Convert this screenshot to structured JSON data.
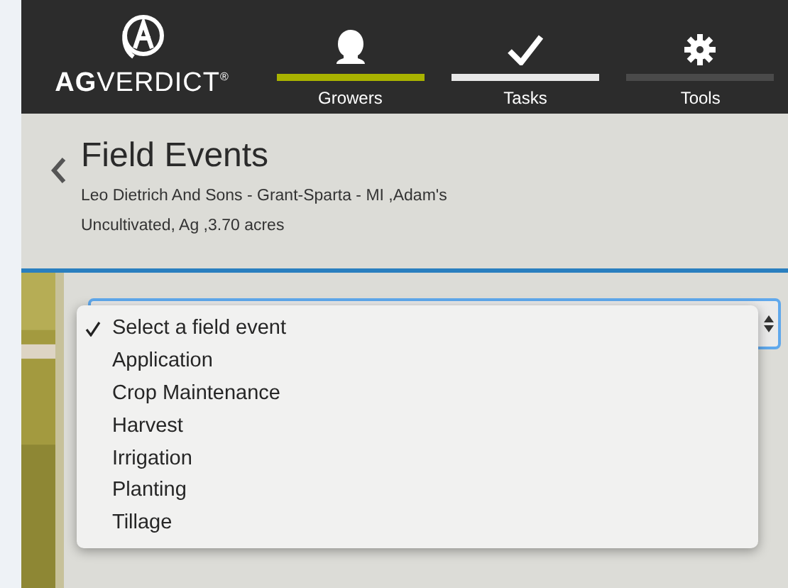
{
  "brand": {
    "name_bold": "AG",
    "name_light": "VERDICT",
    "mark": "®"
  },
  "tabs": [
    {
      "label": "Growers",
      "color": "#a9b300"
    },
    {
      "label": "Tasks",
      "color": "#e8e8e8"
    },
    {
      "label": "Tools",
      "color": "#4a4a4a"
    }
  ],
  "header": {
    "title": "Field Events",
    "subtitle_lines": [
      "Leo Dietrich And Sons - Grant-Sparta - MI ,Adam's",
      "Uncultivated, Ag ,3.70 acres"
    ]
  },
  "event_menu": {
    "options": [
      {
        "label": "Select a field event",
        "selected": true
      },
      {
        "label": "Application",
        "selected": false
      },
      {
        "label": "Crop Maintenance",
        "selected": false
      },
      {
        "label": "Harvest",
        "selected": false
      },
      {
        "label": "Irrigation",
        "selected": false
      },
      {
        "label": "Planting",
        "selected": false
      },
      {
        "label": "Tillage",
        "selected": false
      }
    ]
  }
}
